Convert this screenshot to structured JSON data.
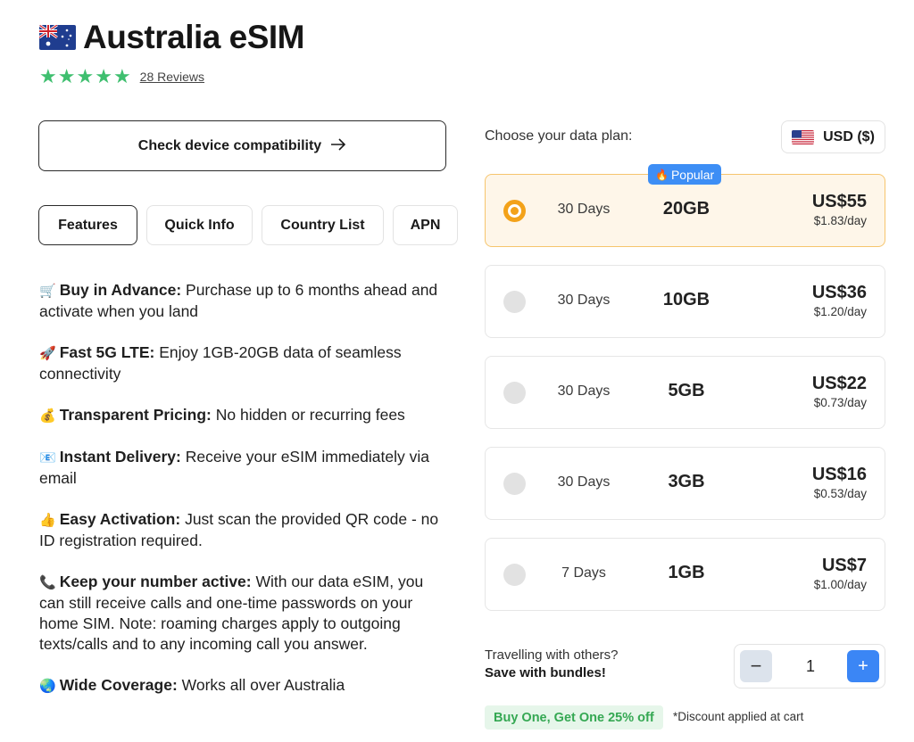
{
  "header": {
    "title": "Australia eSIM",
    "flag_icon": "australia-flag-icon",
    "reviews_link": "28 Reviews",
    "rating_stars": 5
  },
  "compat_button": {
    "label": "Check device compatibility",
    "icon": "arrow-right-icon"
  },
  "tabs": [
    {
      "label": "Features",
      "active": true
    },
    {
      "label": "Quick Info",
      "active": false
    },
    {
      "label": "Country List",
      "active": false
    },
    {
      "label": "APN",
      "active": false
    }
  ],
  "features": [
    {
      "icon": "cart-icon",
      "title": "Buy in Advance:",
      "text": " Purchase up to 6 months ahead and activate when you land"
    },
    {
      "icon": "rocket-icon",
      "title": "Fast 5G LTE:",
      "text": " Enjoy 1GB-20GB data of seamless connectivity"
    },
    {
      "icon": "money-bag-icon",
      "title": "Transparent Pricing:",
      "text": " No hidden or recurring fees"
    },
    {
      "icon": "envelope-icon",
      "title": "Instant Delivery:",
      "text": " Receive your eSIM immediately via email"
    },
    {
      "icon": "thumbs-up-icon",
      "title": "Easy Activation:",
      "text": " Just scan the provided QR code - no ID registration required."
    },
    {
      "icon": "phone-icon",
      "title": "Keep your number active:",
      "text": " With our data eSIM, you can still receive calls and one-time passwords on your home SIM. Note: roaming charges apply to outgoing texts/calls and to any incoming call you answer."
    },
    {
      "icon": "globe-icon",
      "title": "Wide Coverage:",
      "text": " Works all over Australia"
    }
  ],
  "plans_section": {
    "label": "Choose your data plan:",
    "currency": "USD ($)",
    "currency_flag_icon": "us-flag-icon",
    "popular_badge": "Popular",
    "plans": [
      {
        "days": "30 Days",
        "data": "20GB",
        "price": "US$55",
        "per_day": "$1.83/day",
        "selected": true,
        "popular": true
      },
      {
        "days": "30 Days",
        "data": "10GB",
        "price": "US$36",
        "per_day": "$1.20/day",
        "selected": false
      },
      {
        "days": "30 Days",
        "data": "5GB",
        "price": "US$22",
        "per_day": "$0.73/day",
        "selected": false
      },
      {
        "days": "30 Days",
        "data": "3GB",
        "price": "US$16",
        "per_day": "$0.53/day",
        "selected": false
      },
      {
        "days": "7 Days",
        "data": "1GB",
        "price": "US$7",
        "per_day": "$1.00/day",
        "selected": false
      }
    ]
  },
  "bundle": {
    "question": "Travelling with others?",
    "cta": "Save with bundles!",
    "quantity": "1",
    "minus_label": "−",
    "plus_label": "+",
    "promo": "Buy One, Get One 25% off",
    "promo_note": "*Discount applied at cart"
  },
  "colors": {
    "accent_orange": "#f3a21a",
    "selected_bg": "#fef6e9",
    "star_green": "#3fbf6f",
    "primary_blue": "#3b86f5",
    "promo_green": "#35a853"
  }
}
